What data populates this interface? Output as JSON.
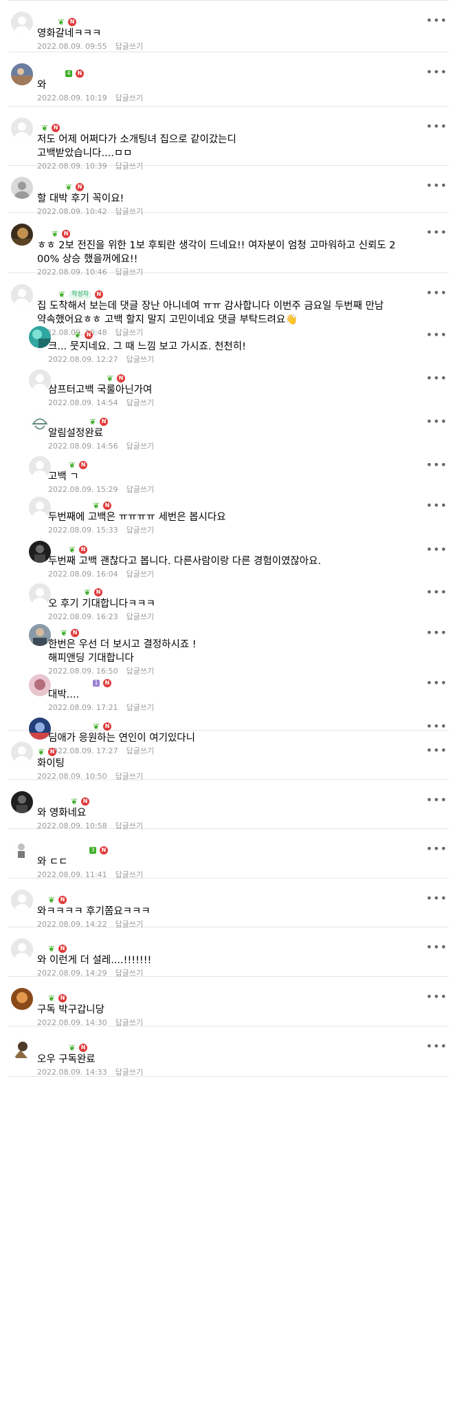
{
  "reply_label": "답글쓰기",
  "comments": [
    {
      "text": "영화갈네ㅋㅋㅋ",
      "date": "2022.08.09. 09:55",
      "avatar": "default",
      "level": "sprout",
      "replies": []
    },
    {
      "text": "와",
      "date": "2022.08.09. 10:19",
      "avatar": "photo-sunset",
      "level": "4",
      "replies": []
    },
    {
      "text": "저도 어제 어쩌다가 소개팅녀 집으로 같이갔는디\n고백받았습니다....ㅁㅁ",
      "date": "2022.08.09. 10:39",
      "avatar": "default",
      "level": "sprout",
      "replies": []
    },
    {
      "text": "할 대박 후기 꼭이요!",
      "date": "2022.08.09. 10:42",
      "avatar": "default-silhouette",
      "level": "sprout",
      "replies": []
    },
    {
      "text": "ㅎㅎ 2보 전진을 위한 1보 후퇴란 생각이 드네요!! 여자분이 엄청 고마워하고 신뢰도 2\n00% 상승 했을꺼에요!!",
      "date": "2022.08.09. 10:46",
      "avatar": "photo-warm",
      "level": "sprout",
      "replies": []
    },
    {
      "text": "집 도착해서 보는데 댓글 장난 아니네여 ㅠㅠ 감사합니다 이번주 금요일 두번째 만남\n약속했어요ㅎㅎ 고백 할지 말지 고민이네요 댓글 부탁드려요👋",
      "date": "2022.08.09. 10:48",
      "avatar": "default",
      "level": "sprout",
      "writer": "작성자",
      "replies": [
        {
          "text": "크... 뭇지네요. 그 때 느낌 보고 가시죠. 천천히!",
          "date": "2022.08.09. 12:27",
          "avatar": "photo-teal",
          "level": "sprout"
        },
        {
          "text": "삼프터고백 국룰아닌가여",
          "date": "2022.08.09. 14:54",
          "avatar": "default",
          "level": "sprout"
        },
        {
          "text": "알림설정완료",
          "date": "2022.08.09. 14:56",
          "avatar": "drawing-helmet",
          "level": "sprout"
        },
        {
          "text": "고백 ㄱ",
          "date": "2022.08.09. 15:29",
          "avatar": "default",
          "level": "sprout"
        },
        {
          "text": "두번째에 고백은 ㅠㅠㅠㅠ 세번은 봅시다요",
          "date": "2022.08.09. 15:33",
          "avatar": "default",
          "level": "sprout"
        },
        {
          "text": "두번째 고백 괜찮다고 봅니다. 다른사람이랑 다른 경험이였잖아요.",
          "date": "2022.08.09. 16:04",
          "avatar": "photo-dark",
          "level": "sprout"
        },
        {
          "text": "오 후기 기대합니다ㅋㅋㅋ",
          "date": "2022.08.09. 16:23",
          "avatar": "default",
          "level": "sprout"
        },
        {
          "text": "한번은 우선 더 보시고 결정하시죠 !\n해피앤딩 기대합니다",
          "date": "2022.08.09. 16:50",
          "avatar": "photo-person",
          "level": "sprout"
        },
        {
          "text": "대박....",
          "date": "2022.08.09. 17:21",
          "avatar": "photo-pink",
          "level": "1"
        },
        {
          "text": "딤애가 응원하는 연인이 여기있다니",
          "date": "2022.08.09. 17:27",
          "avatar": "photo-blue",
          "level": "sprout"
        }
      ]
    },
    {
      "text": "화이팅",
      "date": "2022.08.09. 10:50",
      "avatar": "default",
      "level": "sprout",
      "replies": []
    },
    {
      "text": "와 영화네요",
      "date": "2022.08.09. 10:58",
      "avatar": "photo-dark",
      "level": "sprout",
      "replies": []
    },
    {
      "text": "와 ㄷㄷ",
      "date": "2022.08.09. 11:41",
      "avatar": "drawing-figure",
      "level": "3",
      "replies": []
    },
    {
      "text": "와ㅋㅋㅋㅋ 후기쫌요ㅋㅋㅋ",
      "date": "2022.08.09. 14:22",
      "avatar": "default",
      "level": "sprout",
      "replies": []
    },
    {
      "text": "와 이런게 더 설레....!!!!!!!",
      "date": "2022.08.09. 14:29",
      "avatar": "default",
      "level": "sprout",
      "replies": []
    },
    {
      "text": "구독 박구갑니당",
      "date": "2022.08.09. 14:30",
      "avatar": "photo-orange",
      "level": "sprout",
      "replies": []
    },
    {
      "text": "오우 구독완료",
      "date": "2022.08.09. 14:33",
      "avatar": "photo-cartoon",
      "level": "sprout",
      "replies": []
    }
  ],
  "colors": {
    "sprout": "#3fae2a",
    "new_badge": "#e03a3a",
    "level_1": "#9b7fd1",
    "level_3": "#3fae2a",
    "level_4": "#3fae2a",
    "writer_text": "#1aa35a",
    "date": "#9a9a9a",
    "divider": "#e5e5e5"
  },
  "icons": {
    "more": "more-vert-icon",
    "sprout": "sprout-icon",
    "new": "new-badge-icon"
  }
}
